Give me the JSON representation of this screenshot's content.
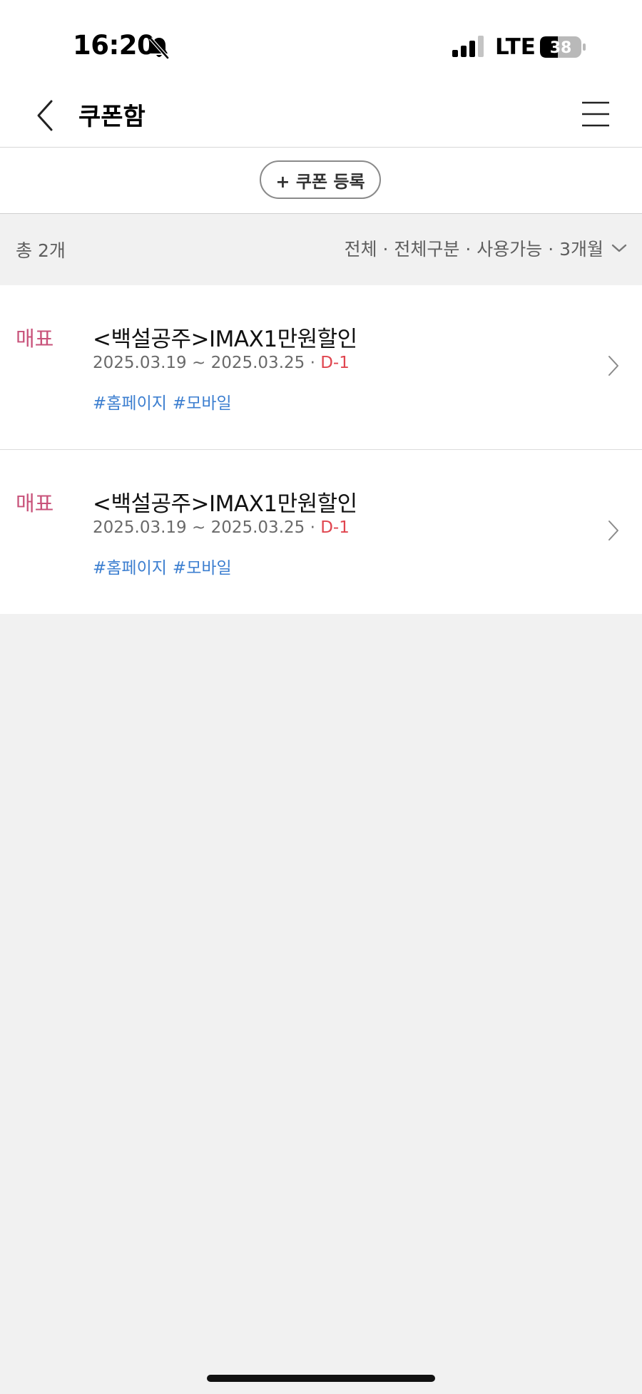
{
  "status_bar": {
    "time": "16:20",
    "network": "LTE",
    "battery_level": "38",
    "icons": [
      "bell-off-icon",
      "signal-icon",
      "battery-icon"
    ]
  },
  "header": {
    "title": "쿠폰함",
    "icons": [
      "back-arrow-icon",
      "hamburger-menu-icon"
    ]
  },
  "register": {
    "label": "+ 쿠폰 등록"
  },
  "filter": {
    "total": "총 2개",
    "summary": "전체 · 전체구분 · 사용가능 · 3개월",
    "icon": "chevron-down-icon"
  },
  "coupons": [
    {
      "type": "매표",
      "name": "<백설공주>IMAX1만원할인",
      "period": "2025.03.19 ~ 2025.03.25",
      "separator": "·",
      "dday": "D-1",
      "tags": [
        "#홈페이지",
        "#모바일"
      ]
    },
    {
      "type": "매표",
      "name": "<백설공주>IMAX1만원할인",
      "period": "2025.03.19 ~ 2025.03.25",
      "separator": "·",
      "dday": "D-1",
      "tags": [
        "#홈페이지",
        "#모바일"
      ]
    }
  ],
  "colors": {
    "coupon_type": "#c8527a",
    "dday": "#e0454f",
    "tag": "#3d7fd0",
    "background": "#f1f1f1"
  }
}
